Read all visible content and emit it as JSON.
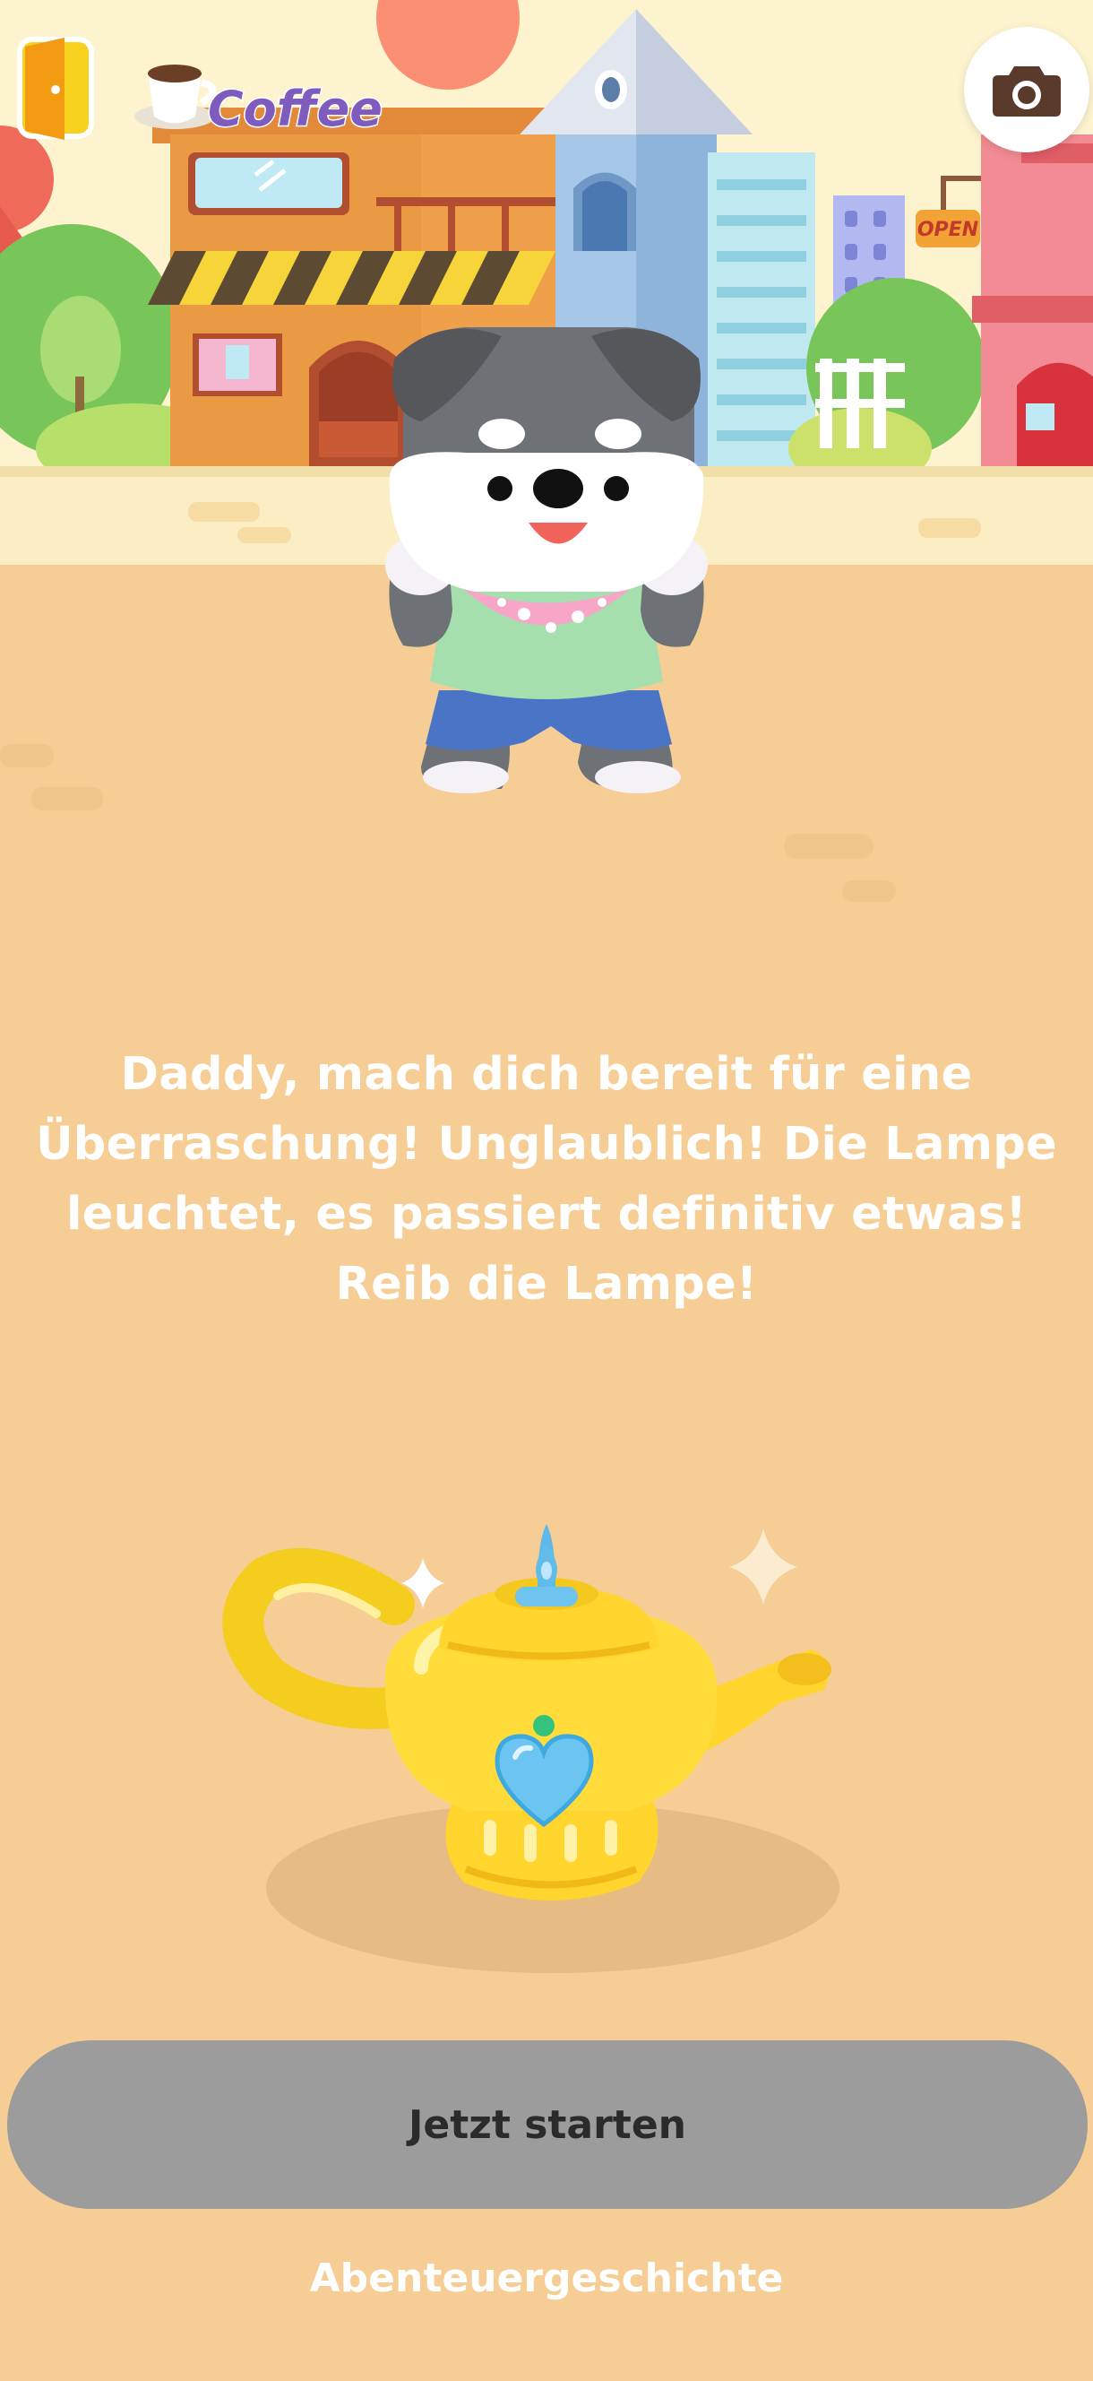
{
  "shop_sign": "Coffee",
  "open_sign": "OPEN",
  "message": "Daddy, mach dich bereit für eine Überraschung! Unglaublich! Die Lampe leuchtet, es passiert definitiv etwas! Reib die Lampe!",
  "start_button": {
    "label": "Jetzt starten"
  },
  "story_link": {
    "label": "Abenteuergeschichte"
  },
  "icons": {
    "exit": "door-exit-icon",
    "camera": "camera-icon",
    "lamp": "magic-lamp",
    "character": "dog-character"
  },
  "colors": {
    "background": "#f5cd95",
    "button": "#9c9c9c",
    "text": "#ffffff",
    "lamp": "#ffd52e"
  }
}
